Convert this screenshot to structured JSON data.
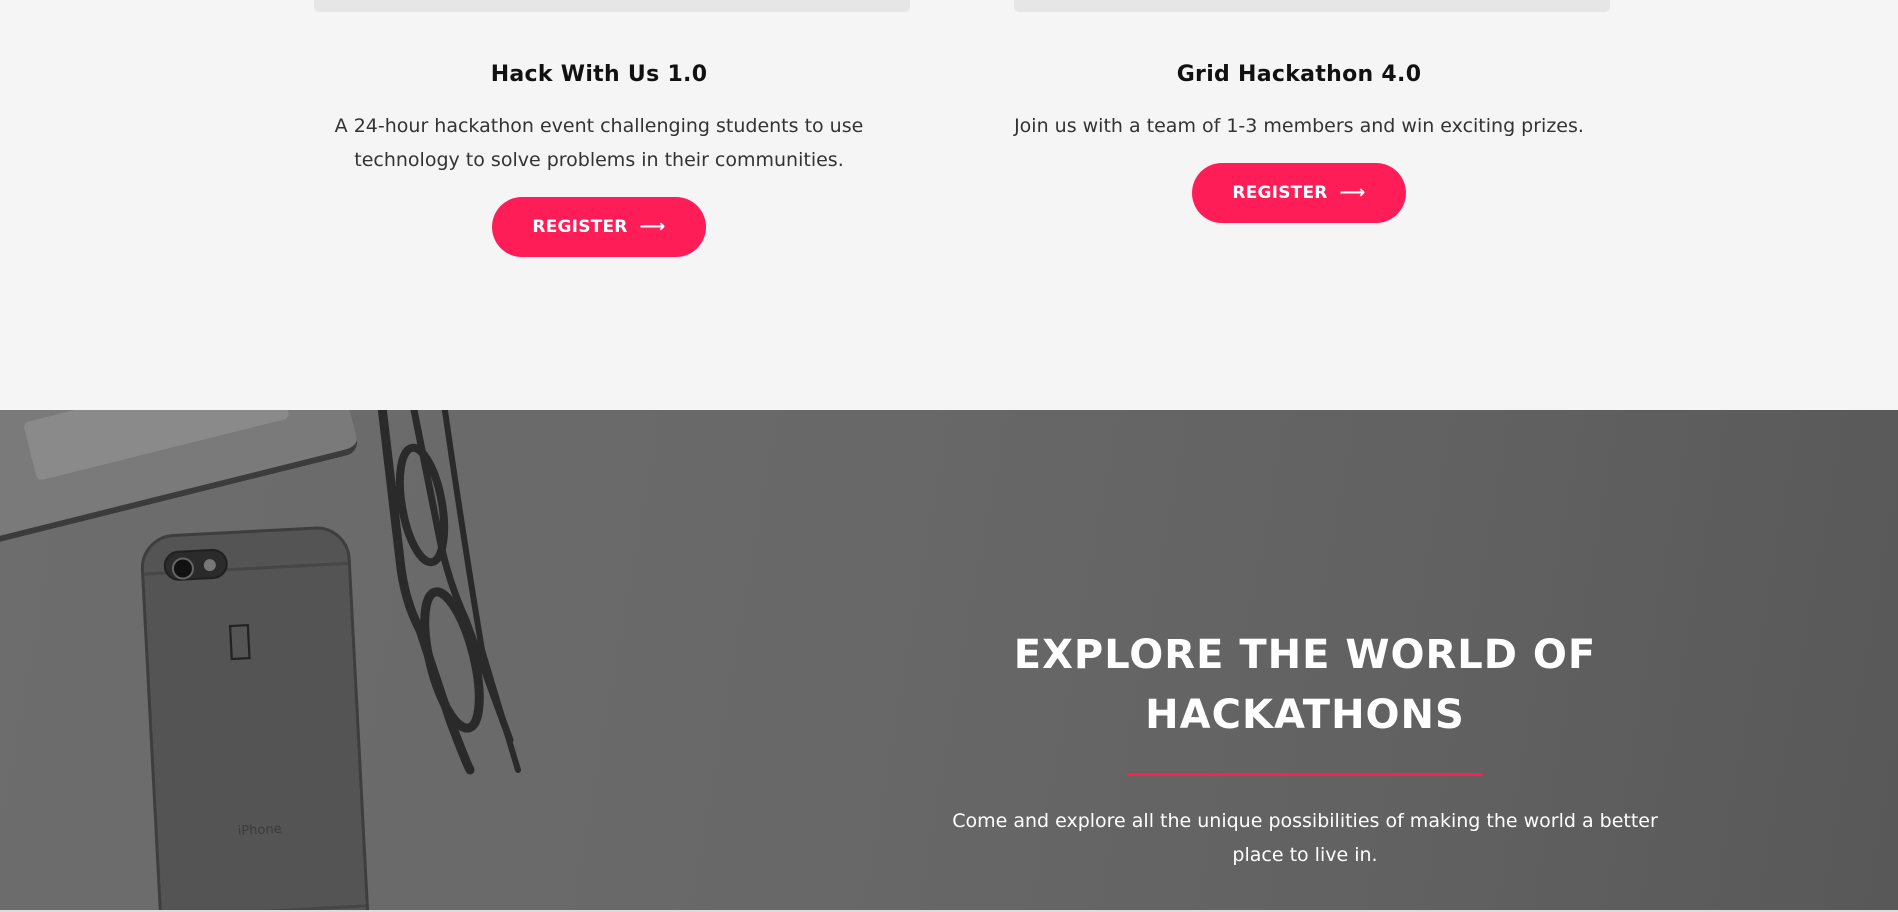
{
  "events": [
    {
      "title": "Hack With Us 1.0",
      "description": "A 24-hour hackathon event challenging students to use technology to solve problems in their communities.",
      "button_label": "REGISTER"
    },
    {
      "title": "Grid Hackathon 4.0",
      "description": "Join us with a team of 1-3 members and win exciting prizes.",
      "button_label": "REGISTER"
    }
  ],
  "hero": {
    "heading": "EXPLORE THE WORLD OF HACKATHONS",
    "subtext": "Come and explore all the unique possibilities of making the world a better place to live in.",
    "image_text": "iPhone"
  },
  "colors": {
    "accent": "#ff1d58",
    "hero_overlay": "#666666",
    "section_bg": "#f5f5f5"
  },
  "icons": {
    "button_arrow": "arrow-right-icon"
  }
}
